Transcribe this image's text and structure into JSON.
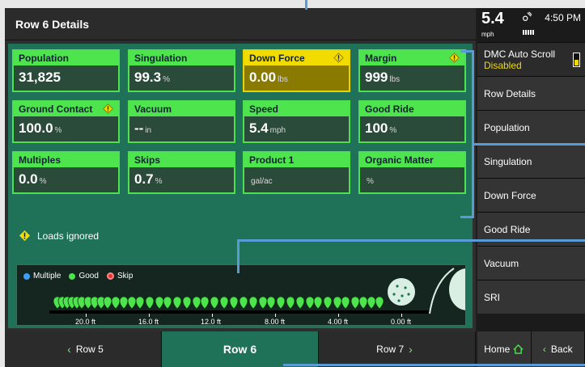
{
  "header": {
    "title": "Row 6 Details"
  },
  "tiles": [
    {
      "label": "Population",
      "value": "31,825",
      "unit": "",
      "warn": false,
      "icon": false
    },
    {
      "label": "Singulation",
      "value": "99.3",
      "unit": "%",
      "warn": false,
      "icon": false
    },
    {
      "label": "Down Force",
      "value": "0.00",
      "unit": "lbs",
      "warn": true,
      "icon": true
    },
    {
      "label": "Margin",
      "value": "999",
      "unit": "lbs",
      "warn": false,
      "icon": true
    },
    {
      "label": "Ground Contact",
      "value": "100.0",
      "unit": "%",
      "warn": false,
      "icon": true
    },
    {
      "label": "Vacuum",
      "value": "--",
      "unit": "in",
      "warn": false,
      "icon": false
    },
    {
      "label": "Speed",
      "value": "5.4",
      "unit": "mph",
      "warn": false,
      "icon": false
    },
    {
      "label": "Good Ride",
      "value": "100",
      "unit": "%",
      "warn": false,
      "icon": false
    },
    {
      "label": "Multiples",
      "value": "0.0",
      "unit": "%",
      "warn": false,
      "icon": false
    },
    {
      "label": "Skips",
      "value": "0.7",
      "unit": "%",
      "warn": false,
      "icon": false
    },
    {
      "label": "Product 1",
      "value": "",
      "unit": "gal/ac",
      "warn": false,
      "icon": false
    },
    {
      "label": "Organic Matter",
      "value": "",
      "unit": "%",
      "warn": false,
      "icon": false
    }
  ],
  "loads_message": "Loads ignored",
  "seed_view": {
    "legend": [
      "Multiple",
      "Good",
      "Skip"
    ],
    "colors": {
      "multiple": "#3aa0ff",
      "good": "#4ee44e",
      "skip": "#e33333"
    },
    "ticks": [
      "20.0 ft",
      "16.0 ft",
      "12.0 ft",
      "8.00 ft",
      "4.00 ft",
      "0.00 ft"
    ]
  },
  "nav": {
    "prev": "Row 5",
    "current": "Row 6",
    "next": "Row 7"
  },
  "status": {
    "speed": "5.4",
    "speed_unit": "mph",
    "time": "4:50 PM"
  },
  "sidebar": {
    "auto_scroll_label": "DMC Auto Scroll",
    "auto_scroll_state": "Disabled",
    "items": [
      "Row Details",
      "Population",
      "Singulation",
      "Down Force",
      "Good Ride",
      "Vacuum",
      "SRI"
    ],
    "home": "Home",
    "back": "Back"
  }
}
